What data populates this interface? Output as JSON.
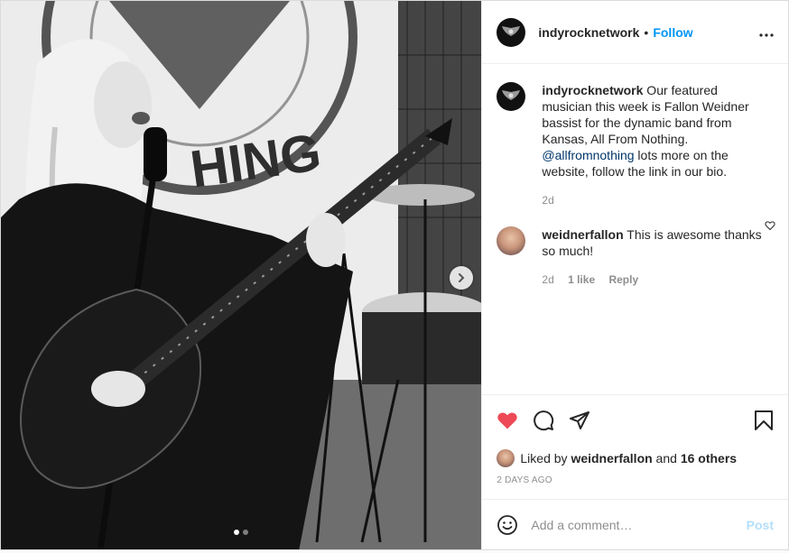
{
  "post": {
    "username": "indyrocknetwork",
    "separator": "•",
    "follow_label": "Follow",
    "more_label": "•••",
    "caption_user": "indyrocknetwork",
    "caption_text_1": " Our featured musician this week is Fallon Weidner bassist for the dynamic band from Kansas, All From Nothing. ",
    "caption_mention": "@allfromnothing",
    "caption_text_2": " lots more on the website, follow the link in our bio.",
    "caption_time": "2d",
    "photo_text": "HING"
  },
  "comment": {
    "username": "weidnerfallon",
    "text": " This is awesome thanks so much!",
    "time": "2d",
    "likes": "1 like",
    "reply_label": "Reply"
  },
  "likes": {
    "prefix": "Liked by ",
    "user": "weidnerfallon",
    "middle": " and ",
    "others": "16 others"
  },
  "timestamp": "2 DAYS AGO",
  "add_comment": {
    "placeholder": "Add a comment…",
    "post_label": "Post"
  },
  "colors": {
    "heart": "#ed4956",
    "link": "#0095f6",
    "mention": "#00376b",
    "post_disabled": "#b2dffc"
  },
  "icons": [
    "heart-icon",
    "comment-icon",
    "share-icon",
    "bookmark-icon",
    "emoji-icon",
    "chevron-right-icon",
    "more-icon"
  ]
}
